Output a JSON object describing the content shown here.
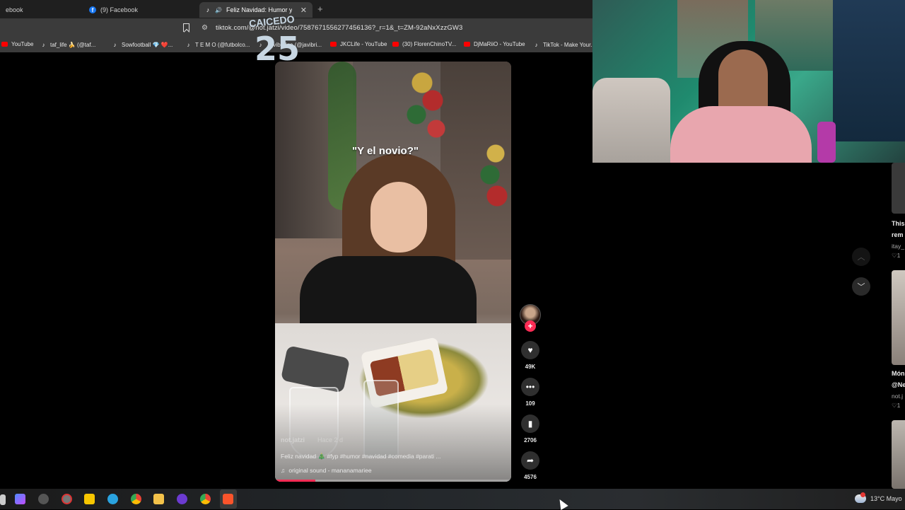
{
  "browser": {
    "tabs": [
      {
        "label": "ebook",
        "icon": "facebook-icon"
      },
      {
        "label": "(9) Facebook",
        "icon": "facebook-icon"
      },
      {
        "label": "Feliz Navidad: Humor y Come",
        "icon": "tiktok-icon",
        "active": true
      }
    ],
    "url": "tiktok.com/@not.jatzi/video/7587671556277456136?_r=1&_t=ZM-92aNxXzzGW3",
    "bookmarks": [
      {
        "label": "YouTube",
        "icon": "youtube-icon"
      },
      {
        "label": "taf_life 🍌 (@taf...",
        "icon": "tiktok-icon"
      },
      {
        "label": "Sowfootball 💎 ❤️...",
        "icon": "tiktok-icon"
      },
      {
        "label": "T E M O (@futbolco...",
        "icon": "tiktok-icon"
      },
      {
        "label": "Javibridge (@javibri...",
        "icon": "tiktok-icon"
      },
      {
        "label": "JKCLife - YouTube",
        "icon": "youtube-icon"
      },
      {
        "label": "(30) FlorenChinoTV...",
        "icon": "youtube-icon"
      },
      {
        "label": "DjMaRiiO - YouTube",
        "icon": "youtube-icon"
      },
      {
        "label": "TikTok - Make Your...",
        "icon": "tiktok-icon"
      }
    ]
  },
  "video": {
    "caption_overlay": "\"Y el novio?\"",
    "author": "not.jatzi",
    "date": "Hace 2 d",
    "description": "Feliz navidad 🎄 #fyp #humor #navidad #comedia #parati ...",
    "sound": "original sound - mananamariee",
    "progress": 0.17
  },
  "actions": {
    "likes": "49K",
    "comments": "109",
    "saves": "2706",
    "shares": "4576"
  },
  "side_feed": {
    "card1_title_a": "This",
    "card1_title_b": "rem",
    "card1_author": "itay_",
    "card1_likes": "1",
    "card2_title_a": "Món",
    "card2_title_b": "@Ne",
    "card2_author": "not.j",
    "card2_likes": "1"
  },
  "webcam": {
    "jersey_name": "CAICEDO",
    "jersey_number": "25"
  },
  "taskbar": {
    "weather": "13°C  Mayo"
  },
  "colors": {
    "tiktok_red": "#fe2c55",
    "youtube_red": "#ff0000",
    "facebook_blue": "#1877f2"
  }
}
